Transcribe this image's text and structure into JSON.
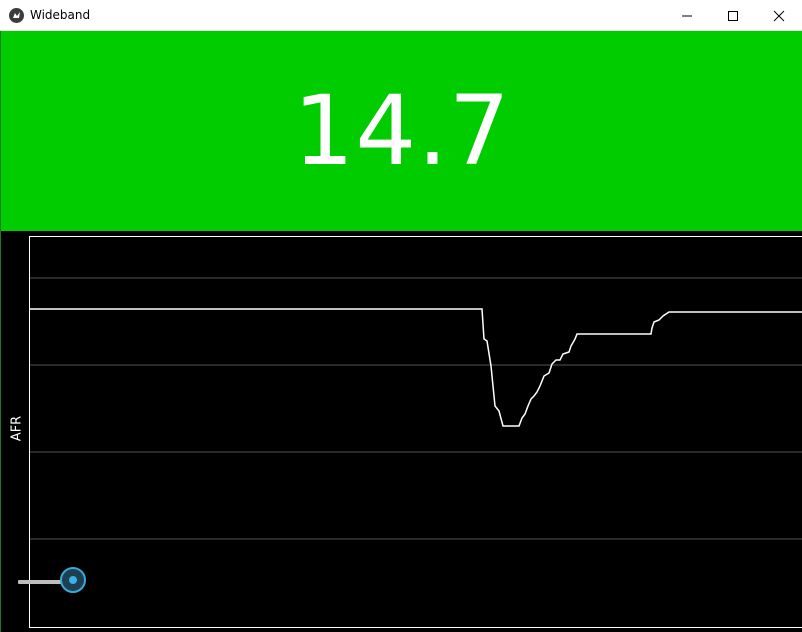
{
  "window": {
    "title": "Wideband",
    "app_icon": "kivy-icon",
    "controls": [
      "minimize-icon",
      "maximize-icon",
      "close-icon"
    ]
  },
  "reading": {
    "value": "14.7",
    "background_color": "#00cc00",
    "text_color": "#ffffff"
  },
  "graph": {
    "ylabel": "AFR",
    "line_color": "#ffffff",
    "grid_color": "#555555",
    "background_color": "#000000"
  },
  "slider": {
    "accent_color": "#38b2e8",
    "level": 1.0
  }
}
